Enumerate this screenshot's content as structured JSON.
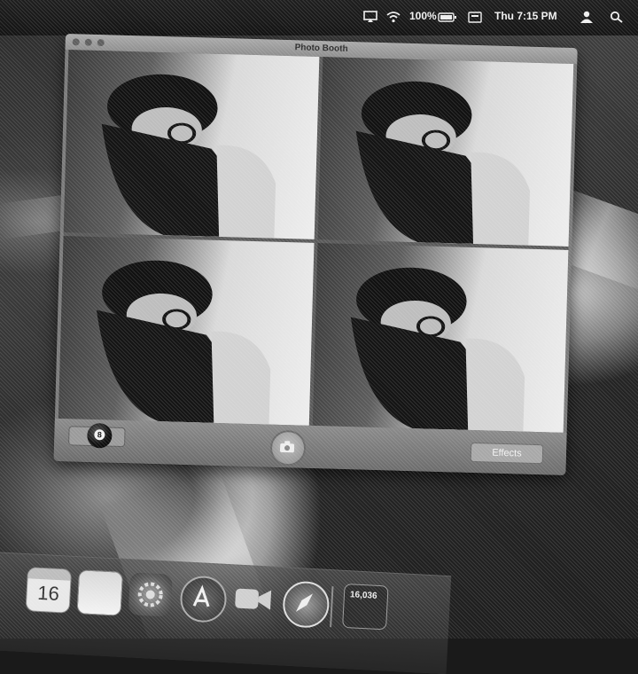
{
  "menubar": {
    "battery": "100%",
    "clock": "Thu 7:15 PM",
    "icons": [
      "airplay-icon",
      "wifi-icon",
      "battery-icon",
      "keyboard-icon",
      "user-icon",
      "spotlight-icon"
    ]
  },
  "window": {
    "title": "Photo Booth",
    "mode_badge": "8",
    "effects_label": "Effects",
    "grid_count": 4
  },
  "dock": {
    "calendar_day": "16",
    "activity_value": "16,036",
    "items": [
      "calendar",
      "notes",
      "system-preferences",
      "app-store",
      "facetime",
      "safari",
      "activity-monitor"
    ]
  },
  "colors": {
    "menubar": "#141414",
    "window": "#7a7a7a",
    "toolbar": "#6c6c6c"
  }
}
